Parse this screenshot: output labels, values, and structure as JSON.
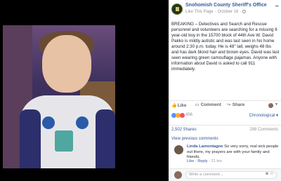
{
  "post": {
    "page_name": "Snohomish County Sheriff's Office",
    "like_page": "Like This Page",
    "date": "October 16",
    "text": "BREAKING – Detectives and Search and Rescue personnel and volunteers are searching for a missing 6 year-old boy in the 15700 block of 44th Ave W. David Pakko is mildly autistic and was last seen in his home around 2:30 p.m. today. He is 48\" tall, weighs 48 lbs and has dark blond hair and brown eyes. David was last seen wearing green camouflage pajamas. Anyone with information about David is asked to call 911 immediately."
  },
  "actions": {
    "like": "Like",
    "comment": "Comment",
    "share": "Share"
  },
  "stats": {
    "reactions_count": "456",
    "order": "Chronological",
    "shares": "2,502 Shares",
    "comments": "298 Comments",
    "view_previous": "View previous comments"
  },
  "comment": {
    "author": "Linda Lamontagne",
    "text": "So very sorry, real sick people out there, my prayers are with your family and friends.",
    "like": "Like",
    "reply": "Reply",
    "time": "21 hrs"
  },
  "composer": {
    "placeholder": "Write a comment..."
  },
  "icons": {
    "logo": "sheriff-badge-icon",
    "globe": "globe-icon",
    "more": "more-dots-icon",
    "like": "thumbs-up-icon",
    "comment": "speech-bubble-icon",
    "share": "share-arrow-icon"
  },
  "colors": {
    "link": "#365899",
    "muted": "#90949c",
    "like_reaction": "#5890ff",
    "sad_reaction": "#f7b125",
    "love_reaction": "#f25268"
  }
}
